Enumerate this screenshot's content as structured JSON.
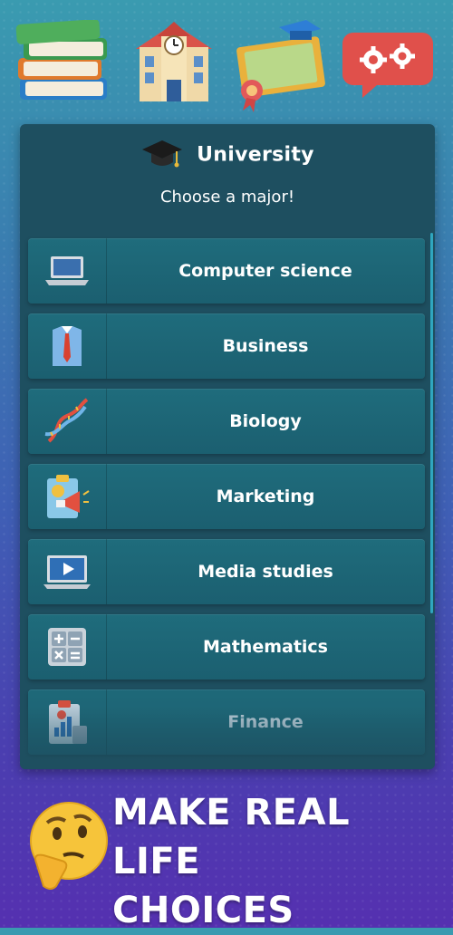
{
  "panel": {
    "title": "University",
    "subtitle": "Choose a major!"
  },
  "majors": [
    {
      "label": "Computer science",
      "icon": "laptop-icon"
    },
    {
      "label": "Business",
      "icon": "shirt-tie-icon"
    },
    {
      "label": "Biology",
      "icon": "dna-icon"
    },
    {
      "label": "Marketing",
      "icon": "megaphone-clipboard-icon"
    },
    {
      "label": "Media studies",
      "icon": "play-screen-icon"
    },
    {
      "label": "Mathematics",
      "icon": "calculator-icon"
    },
    {
      "label": "Finance",
      "icon": "finance-chart-icon"
    }
  ],
  "banner": {
    "line1": "MAKE REAL LIFE",
    "line2": "CHOICES"
  },
  "colors": {
    "panel": "#1e4f60",
    "row": "#1b6474",
    "accent": "#2fa6bf"
  }
}
